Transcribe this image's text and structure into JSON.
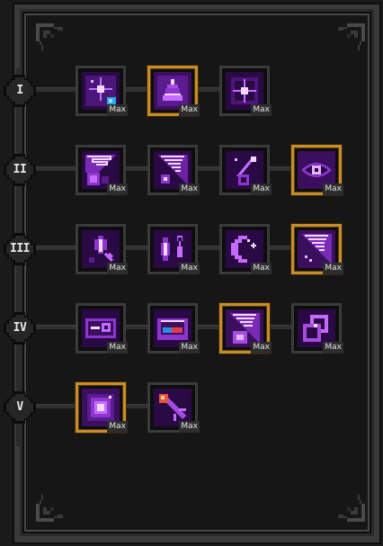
{
  "skill_tree": {
    "tiers": [
      {
        "numeral": "I",
        "skills": [
          {
            "icon": "starburst-orb-icon",
            "max_label": "Max",
            "framed": false
          },
          {
            "icon": "arcane-dome-icon",
            "max_label": "Max",
            "framed": true
          },
          {
            "icon": "compass-star-icon",
            "max_label": "Max",
            "framed": false
          }
        ]
      },
      {
        "numeral": "II",
        "skills": [
          {
            "icon": "arcane-slash-icon",
            "max_label": "Max",
            "framed": false
          },
          {
            "icon": "void-slash-icon",
            "max_label": "Max",
            "framed": false
          },
          {
            "icon": "falling-comet-icon",
            "max_label": "Max",
            "framed": false
          },
          {
            "icon": "watching-eye-icon",
            "max_label": "Max",
            "framed": true
          }
        ]
      },
      {
        "numeral": "III",
        "skills": [
          {
            "icon": "crystal-spark-icon",
            "max_label": "Max",
            "framed": false
          },
          {
            "icon": "twin-crystal-icon",
            "max_label": "Max",
            "framed": false
          },
          {
            "icon": "crescent-moon-icon",
            "max_label": "Max",
            "framed": false
          },
          {
            "icon": "rune-slash-icon",
            "max_label": "Max",
            "framed": true
          }
        ]
      },
      {
        "numeral": "IV",
        "skills": [
          {
            "icon": "time-eye-icon",
            "max_label": "Max",
            "framed": false
          },
          {
            "icon": "mana-bowl-icon",
            "max_label": "Max",
            "framed": false
          },
          {
            "icon": "storm-slash-icon",
            "max_label": "Max",
            "framed": true
          },
          {
            "icon": "linked-rings-icon",
            "max_label": "Max",
            "framed": false
          }
        ]
      },
      {
        "numeral": "V",
        "skills": [
          {
            "icon": "void-vortex-icon",
            "max_label": "Max",
            "framed": true
          },
          {
            "icon": "fire-staff-icon",
            "max_label": "Max",
            "framed": false
          }
        ]
      }
    ]
  },
  "colors": {
    "frame_gold": "#c78d2a",
    "frame_gray": "#3b3b3b",
    "arcane_purple": "#9b3dd6",
    "arcane_glow": "#e6b3ff"
  }
}
